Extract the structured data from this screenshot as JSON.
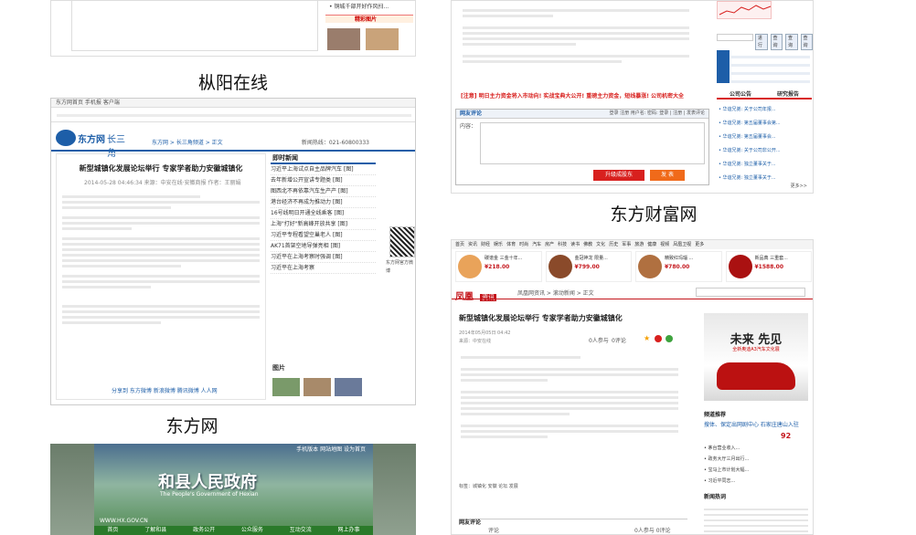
{
  "captions": {
    "zongyang": "枞阳在线",
    "eastday": "东方网",
    "eastmoney": "东方财富网"
  },
  "shotA": {
    "link1": "• 铜城千部开好作风扫...",
    "section": "精彩图片"
  },
  "eastday": {
    "topbar": "东方网首页  手机报  客户端",
    "logo": "东方网",
    "logo_sub": "长三角",
    "breadcrumb": "东方网 > 长三角频道 > 正文",
    "right_tag": "新闻热线：021-60800333",
    "title": "新型城镇化发展论坛举行 专家学者助力安徽城镇化",
    "meta": "2014-05-28  04:46:34   来源：中安在线·安徽商报   作者：王丽娟",
    "side_title": "即时新闻",
    "side_items": [
      "习近平上海试点自主品牌汽车 [图]",
      "去年新增公开宣讲专题类 [图]",
      "图西北不再依靠汽车生产产 [图]",
      "港台经济不再成为推动力 [图]",
      "16号线明日开通全线乘客 [图]",
      "上海\"打好\"新高峰开放共享 [图]",
      "习近平专程看望空巢老人 [图]",
      "AK71首架空地导弹亮相 [图]",
      "习近平在上海考察时强调 [图]",
      "习近平在上海考察"
    ],
    "qr_label": "东方网官方微博",
    "pics_title": "图片",
    "bottom_links": "分享到  东方微博  新浪微博  腾讯微博  人人网"
  },
  "gov": {
    "title": "和县人民政府",
    "subtitle": "The People's Government of Hexian",
    "url": "WWW.HX.GOV.CN",
    "nav": [
      "首页",
      "了解和县",
      "政务公开",
      "公众服务",
      "互动交流",
      "网上办事"
    ],
    "top_links": "手机版本  网站地图  设为首页"
  },
  "eastmoney": {
    "stock_label": "行情",
    "buttons": [
      "进行",
      "查询",
      "查询",
      "查询"
    ],
    "links": [
      "[注意] 明日主力资金将入市动向!  实战宝典大公开! 重磅主力资金，短线暴涨!  公司机密大全"
    ],
    "reply_title": "网友评论",
    "login": "登录  注册  用户名:  密码:  登录 | 注册 | 发表评论",
    "reply_input_label": "内容：",
    "submit": "发 表",
    "cancel": "升级成股东",
    "side_tabs": [
      "公司公告",
      "研究报告"
    ],
    "side_items": [
      "• 华谊兄弟: 关于公司年报...",
      "• 华谊兄弟: 第五届董事会第...",
      "• 华谊兄弟: 第五届董事会...",
      "• 华谊兄弟: 关于公司非公开...",
      "• 华谊兄弟: 独立董事关于...",
      "• 华谊兄弟: 独立董事关于..."
    ],
    "more": "更多>>"
  },
  "ifeng": {
    "nav": [
      "首页",
      "资讯",
      "财经",
      "娱乐",
      "体育",
      "时尚",
      "汽车",
      "房产",
      "科技",
      "读书",
      "佛教",
      "文化",
      "历史",
      "军事",
      "旅游",
      "健康",
      "视频",
      "凤凰卫视",
      "更多"
    ],
    "ads": [
      {
        "name": "碳谱金 三金十年...",
        "price": "¥218.00"
      },
      {
        "name": "金冠神龙 限量...",
        "price": "¥799.00"
      },
      {
        "name": "精致红玛瑙 ...",
        "price": "¥780.00"
      },
      {
        "name": "新品典 三重套...",
        "price": "¥1588.00"
      }
    ],
    "logo": "凤凰",
    "logo_sub": "资讯",
    "breadcrumb": "凤凰网资讯 > 滚动新闻 > 正文",
    "title": "新型城镇化发展论坛举行 专家学者助力安徽城镇化",
    "meta": "2014年05月05日 04:42\n来源：中安在线",
    "count1": "0人参与",
    "count2": "0评论",
    "ad_banner_title": "未来 先见",
    "ad_banner_sub": "全新奥迪A3汽车文化展",
    "side_title": "频道推荐",
    "side_item1": "搜体、保定出网剧中心  石家庄唐山入驻",
    "side_item2": "92",
    "side_news_title": "新闻热词",
    "side_news": [
      "• 茅台营业收入...",
      "• 政务大厅三月出行...",
      "• 宝马上市计划大幅...",
      "• 习近平同志..."
    ],
    "reply_title": "网友评论",
    "reply_sub": "评论",
    "reply_count": "0人参与  0评论",
    "tags": "标签：城镇化  安徽  论坛  发展"
  },
  "colors": {
    "eastday_blue": "#1d5ea8",
    "ifeng_red": "#c4161c",
    "gov_green": "#2a7a2a",
    "eastmoney_red": "#d8201e"
  }
}
